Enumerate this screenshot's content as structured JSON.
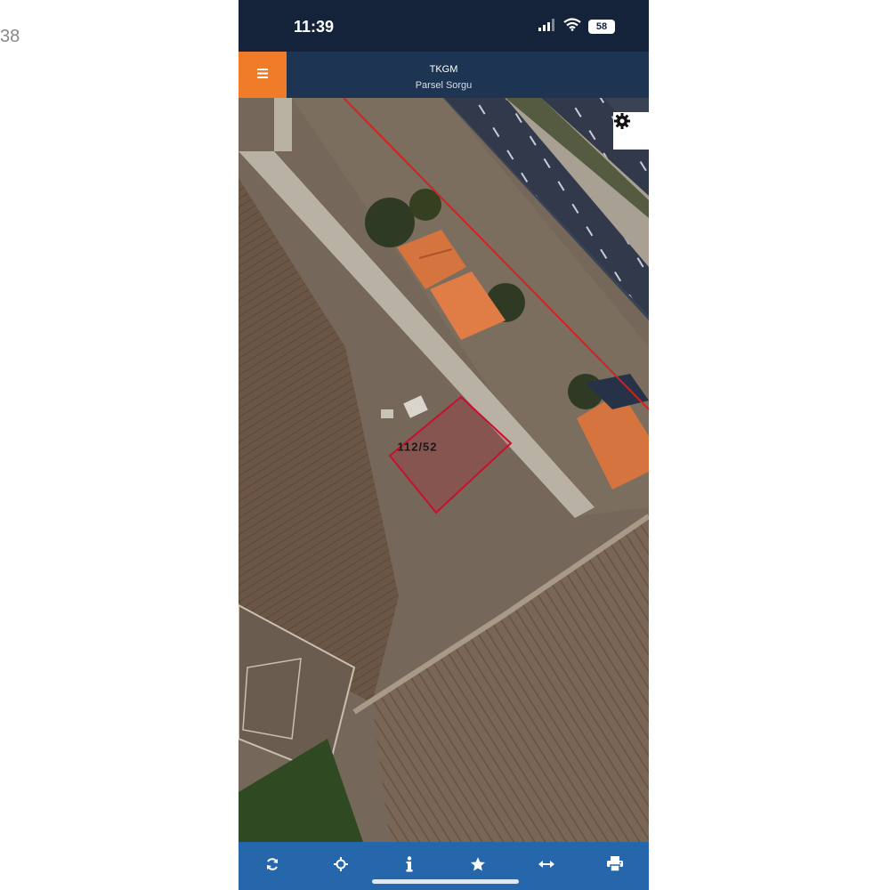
{
  "page": {
    "edge_text": "38"
  },
  "status_bar": {
    "time": "11:39",
    "battery": "58"
  },
  "header": {
    "title": "TKGM",
    "subtitle": "Parsel Sorgu"
  },
  "map": {
    "parcel_label": "112/52"
  },
  "toolbar": {
    "icons": [
      "refresh-icon",
      "locate-icon",
      "info-icon",
      "star-icon",
      "measure-icon",
      "print-icon"
    ]
  },
  "colors": {
    "header_bg": "#1d3553",
    "status_bg": "#14233a",
    "menu_accent": "#f07c2a",
    "toolbar_bg": "#2667ab",
    "parcel_border": "#c8102e",
    "boundary_line": "#d62020"
  }
}
